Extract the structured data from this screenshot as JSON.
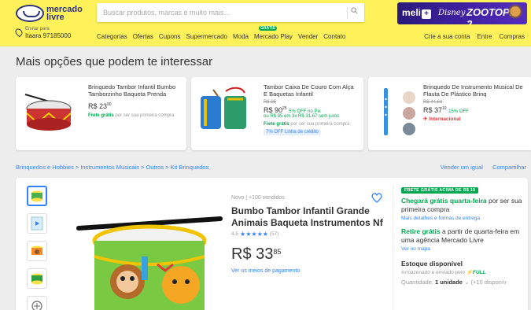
{
  "header": {
    "logo_text_1": "mercado",
    "logo_text_2": "livre",
    "search_placeholder": "Buscar produtos, marcas e muito mais…",
    "promo": {
      "meli": "meli",
      "plus": "+",
      "disney": "Disney",
      "zootopia": "ZOOTOPIA 2"
    },
    "address_label": "Enviar para",
    "address_value": "Itaara 97185000",
    "nav": [
      "Categorias",
      "Ofertas",
      "Cupons",
      "Supermercado",
      "Moda",
      "Mercado Play",
      "Vender",
      "Contato"
    ],
    "nav_badge": "GRÁTIS",
    "account_nav": [
      "Crie a sua conta",
      "Entre",
      "Compras"
    ]
  },
  "recommendations": {
    "title": "Mais opções que podem te interessar",
    "items": [
      {
        "title": "Brinquedo Tambor Infantil Bumbo Tamborzinho Baqueta Prenda",
        "price_int": "R$ 23",
        "price_cents": "90",
        "shipping": "Frete grátis",
        "shipping_note": "por ser sua primeira compra"
      },
      {
        "title": "Tambor Caixa De Couro Com Alça E Baquetas Infantil",
        "old_price": "R$ 95",
        "price_int": "R$ 90",
        "price_cents": "25",
        "discount": "5% OFF no Pix",
        "installments": "ou R$ 95 em 3x R$ 31,67 sem juros",
        "shipping": "Frete grátis",
        "shipping_note": "por ser sua primeira compra",
        "coupon": "7% OFF Linha de crédito"
      },
      {
        "title": "Brinquedo De Instrumento Musical De Flauta De Plástico Brinq",
        "old_price": "R$ 44,60",
        "price_int": "R$ 37",
        "price_cents": "10",
        "discount": "15% OFF",
        "international": "Internacional"
      }
    ]
  },
  "breadcrumb": {
    "path": "Brinquedos e Hobbies > Instrumentos Musicais > Outros > Kit Brinquedos",
    "actions": [
      "Vender um igual",
      "Compartilhar"
    ]
  },
  "product": {
    "condition": "Novo | +100 vendidos",
    "title": "Bumbo Tambor Infantil Grande Animais Baqueta Instrumentos Nf",
    "rating_value": "4.5",
    "stars": "★★★★★",
    "rating_count": "(57)",
    "price_int": "R$ 33",
    "price_cents": "85",
    "payment_link": "Ver os meios de pagamento"
  },
  "sidebar": {
    "free_badge": "FRETE GRÁTIS ACIMA DE R$ 19",
    "ship_bold": "Chegará grátis quarta-feira",
    "ship_rest": " por ser sua primeira compra",
    "ship_link": "Mais detalhes e formas de entrega",
    "pickup_bold": "Retire grátis",
    "pickup_rest": " a partir de quarta-feira em uma agência Mercado Livre",
    "pickup_link": "Ver no mapa",
    "stock_title": "Estoque disponível",
    "stored_text": "Armazenado e enviado pelo ",
    "stored_full": "⚡FULL",
    "qty_label": "Quantidade: ",
    "qty_value": "1 unidade",
    "qty_available": " (+10 disponív"
  },
  "colors": {
    "header_bg": "#fff159",
    "link": "#3483fa",
    "green": "#00a650",
    "page_bg": "#ededed"
  }
}
